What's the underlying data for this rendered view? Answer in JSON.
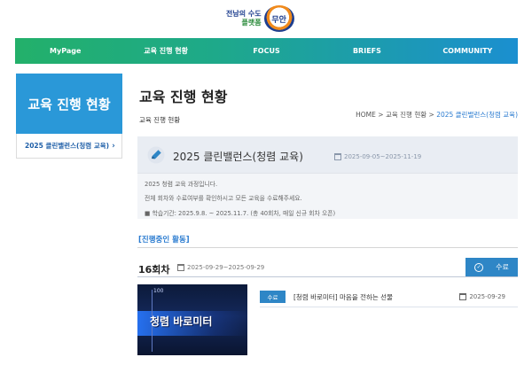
{
  "logo": {
    "line1": "전남의 수도",
    "line2": "플랫폼",
    "badge": "무안"
  },
  "nav": [
    {
      "label": "MyPage"
    },
    {
      "label": "교육 진행 현황"
    },
    {
      "label": "FOCUS"
    },
    {
      "label": "BRIEFS"
    },
    {
      "label": "COMMUNITY"
    }
  ],
  "sidebar": {
    "title": "교육 진행 현황",
    "item": "2025 클린밸런스(청렴 교육)",
    "chevron": "›"
  },
  "page": {
    "title": "교육 진행 현황",
    "subtitle": "교육 진행 현황"
  },
  "breadcrumb": {
    "home": "HOME",
    "sep": " > ",
    "parent": "교육 진행 현황",
    "current": "2025 클린밸런스(청렴 교육)"
  },
  "course": {
    "title": "2025 클린밸런스(청렴 교육)",
    "date": "2025-09-05~2025-11-19",
    "desc1": "2025 청렴 교육 과정입니다.",
    "desc2": "전체 회차와 수료여부를 확인하시고 모든 교육을 수료해주세요.",
    "desc3": "■ 학습기간: 2025.9.8. ~ 2025.11.7. (총 40회차, 매일 신규 회차 오픈)"
  },
  "section": {
    "label": "[진행중인 활동]"
  },
  "round": {
    "title": "16회차",
    "date": "2025-09-29~2025-09-29",
    "done_label": "수료",
    "check": "✓"
  },
  "thumbnail": {
    "meter_value": "100",
    "text": "청렴 바로미터"
  },
  "lesson": {
    "badge": "수료",
    "title": "[청렴 바로미터] 마음을 전하는 선물",
    "date": "2025-09-29"
  },
  "colors": {
    "accent": "#2a98d8",
    "button": "#2e86c6",
    "nav_start": "#23b06a",
    "nav_end": "#1b8fd0"
  }
}
